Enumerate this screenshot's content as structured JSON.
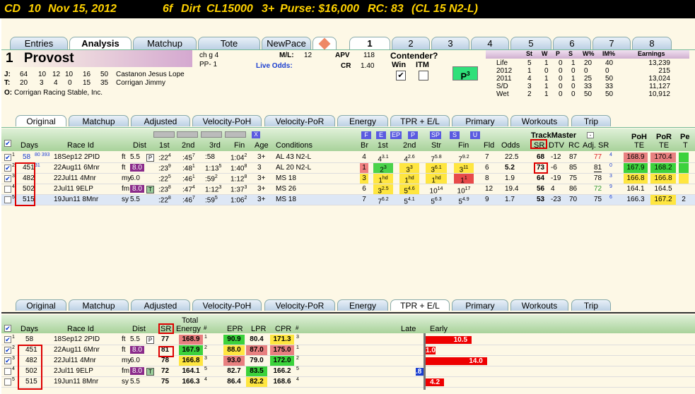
{
  "title": {
    "track": "CD",
    "race": "10",
    "date": "Nov 15, 2012",
    "dist": "6f",
    "surface": "Dirt",
    "class": "CL15000",
    "age": "3+",
    "purse": "Purse: $16,000",
    "rc": "RC: 83",
    "cond": "(CL 15 N2-L)"
  },
  "main_tabs": [
    "Entries",
    "Analysis",
    "Matchup",
    "Tote",
    "NewPace"
  ],
  "post_tabs": [
    "1",
    "2",
    "3",
    "4",
    "5",
    "6",
    "7",
    "8"
  ],
  "horse": {
    "number": "1",
    "name": "Provost",
    "desc": "ch g 4",
    "pp": "PP- 1",
    "ml_label": "M/L:",
    "ml": "12",
    "live_odds": "Live Odds:",
    "apv_label": "APV",
    "apv": "118",
    "cr_label": "CR",
    "cr": "1.40",
    "contender": "Contender?",
    "win": "Win",
    "itm": "ITM",
    "p_badge": "P",
    "p_sup": "3",
    "j_label": "J:",
    "j_stats": [
      "64",
      "10",
      "12",
      "10",
      "16",
      "50"
    ],
    "jockey": "Castanon Jesus Lope",
    "t_label": "T:",
    "t_stats": [
      "20",
      "3",
      "4",
      "0",
      "15",
      "35"
    ],
    "trainer": "Corrigan Jimmy",
    "o_label": "O:",
    "owner": "Corrigan Racing Stable, Inc."
  },
  "record": {
    "headers": [
      "St",
      "W",
      "P",
      "S",
      "W%",
      "IM%",
      "Earnings"
    ],
    "rows": [
      [
        "Life",
        "5",
        "1",
        "0",
        "1",
        "20",
        "40",
        "13,239"
      ],
      [
        "2012",
        "1",
        "0",
        "0",
        "0",
        "0",
        "0",
        "215"
      ],
      [
        "2011",
        "4",
        "1",
        "0",
        "1",
        "25",
        "50",
        "13,024"
      ],
      [
        "S/D",
        "3",
        "1",
        "0",
        "0",
        "33",
        "33",
        "11,127"
      ],
      [
        "Wet",
        "2",
        "1",
        "0",
        "0",
        "50",
        "50",
        "10,912"
      ]
    ]
  },
  "sub_tabs": [
    "Original",
    "Matchup",
    "Adjusted",
    "Velocity-PoH",
    "Velocity-PoR",
    "Energy",
    "TPR + E/L",
    "Primary",
    "Workouts",
    "Trip"
  ],
  "top_table": {
    "headers": {
      "days": "Days",
      "race": "Race Id",
      "dist": "Dist",
      "first": "1st",
      "second": "2nd",
      "third": "3rd",
      "fin": "Fin",
      "age": "Age",
      "cond": "Conditions",
      "br": "Br",
      "c1": "1st",
      "c2": "2nd",
      "str": "Str",
      "cfin": "Fin",
      "fld": "Fld",
      "odds": "Odds",
      "trackmaster": "TrackMaster",
      "sr": "SR",
      "dtv": "DTV",
      "rc": "RC",
      "adjsr": "Adj. SR",
      "poh": "PoH",
      "pohte": "TE",
      "por": "PoR",
      "porte": "TE",
      "pe": "Pe",
      "pete": "T"
    },
    "pace_keys": [
      "F",
      "E",
      "EP",
      "P",
      "SP",
      "S",
      "U"
    ],
    "x_key": "X",
    "rows": [
      {
        "n": "1",
        "days": "58",
        "days_sup": "80 393",
        "race": "18Sep12 2PID",
        "surf": "ft",
        "dist": "5.5",
        "dbadge": "P",
        "f1": ":22",
        "f1s": "4",
        "f2": ":45",
        "f2s": "7",
        "f3": ":58",
        "fin": "1:04",
        "fins": "2",
        "age": "3+",
        "cond": "AL 43 N2-L",
        "br": "4",
        "c1": "4",
        "c1s": "3.1",
        "c2": "4",
        "c2s": "2.6",
        "str": "7",
        "strs": "5.8",
        "cfin": "7",
        "cfins": "9.2",
        "fld": "7",
        "odds": "22.5",
        "sr": "68",
        "dtv": "-12",
        "rc": "87",
        "adj": "77",
        "adjs": "4",
        "poh": "168.9",
        "por": "170.4",
        "pe": ""
      },
      {
        "n": "2",
        "days": "451",
        "days_sup": "31",
        "race": "22Aug11 6Mnr",
        "surf": "ft",
        "dist": "8.0",
        "dbadge": "",
        "f1": ":23",
        "f1s": "9",
        "f2": ":48",
        "f2s": "1",
        "f3": "1:13",
        "f3s": "5",
        "fin": "1:40",
        "fins": "8",
        "age": "3",
        "cond": "AL 20 N2-L",
        "br": "1",
        "c1": "2",
        "c1s": "3",
        "c2": "3",
        "c2s": "3",
        "str": "3",
        "strs": "6.1",
        "cfin": "3",
        "cfins": "11",
        "fld": "6",
        "odds": "5.2",
        "sr": "73",
        "dtv": "-6",
        "rc": "85",
        "adj": "81",
        "adjs": "0",
        "poh": "167.9",
        "por": "168.2",
        "pe": ""
      },
      {
        "n": "3",
        "days": "482",
        "days_sup": "",
        "race": "22Jul11 4Mnr",
        "surf": "my",
        "dist": "6.0",
        "dbadge": "",
        "f1": ":22",
        "f1s": "5",
        "f2": ":46",
        "f2s": "1",
        "f3": ":59",
        "f3s": "2",
        "fin": "1:12",
        "fins": "8",
        "age": "3+",
        "cond": "MS 18",
        "br": "3",
        "c1": "1",
        "c1s": "hd",
        "c2": "1",
        "c2s": "hd",
        "str": "1",
        "strs": "hd",
        "cfin": "1",
        "cfins": "1",
        "fld": "8",
        "odds": "1.9",
        "sr": "64",
        "dtv": "-19",
        "rc": "75",
        "adj": "78",
        "adjs": "3",
        "poh": "166.8",
        "por": "166.8",
        "pe": ""
      },
      {
        "n": "4",
        "days": "502",
        "days_sup": "",
        "race": "2Jul11 9ELP",
        "surf": "fm",
        "dist": "8.0",
        "dbadge": "T",
        "f1": ":23",
        "f1s": "8",
        "f2": ":47",
        "f2s": "4",
        "f3": "1:12",
        "f3s": "3",
        "fin": "1:37",
        "fins": "3",
        "age": "3+",
        "cond": "MS 26",
        "br": "6",
        "c1": "3",
        "c1s": "2.5",
        "c2": "5",
        "c2s": "4.6",
        "str": "10",
        "strs": "14",
        "cfin": "10",
        "cfins": "17",
        "fld": "12",
        "odds": "19.4",
        "sr": "56",
        "dtv": "4",
        "rc": "86",
        "adj": "72",
        "adjs": "9",
        "poh": "164.1",
        "por": "164.5",
        "pe": ""
      },
      {
        "n": "5",
        "days": "515",
        "days_sup": "",
        "race": "19Jun11 8Mnr",
        "surf": "sy",
        "dist": "5.5",
        "dbadge": "",
        "f1": ":22",
        "f1s": "8",
        "f2": ":46",
        "f2s": "7",
        "f3": ":59",
        "f3s": "5",
        "fin": "1:06",
        "fins": "2",
        "age": "3+",
        "cond": "MS 18",
        "br": "7",
        "c1": "7",
        "c1s": "6.2",
        "c2": "5",
        "c2s": "4.1",
        "str": "5",
        "strs": "6.3",
        "cfin": "5",
        "cfins": "4.9",
        "fld": "9",
        "odds": "1.7",
        "sr": "53",
        "dtv": "-23",
        "rc": "70",
        "adj": "75",
        "adjs": "6",
        "poh": "166.3",
        "por": "167.2",
        "pe": "2"
      }
    ]
  },
  "bottom_table": {
    "headers": {
      "days": "Days",
      "race": "Race Id",
      "dist": "Dist",
      "sr": "SR",
      "total": "Total",
      "energy": "Energy",
      "hash": "#",
      "epr": "EPR",
      "lpr": "LPR",
      "cpr": "CPR",
      "hash2": "#",
      "late": "Late",
      "early": "Early"
    },
    "rows": [
      {
        "n": "1",
        "days": "58",
        "race": "18Sep12 2PID",
        "surf": "ft",
        "dist": "5.5",
        "dbadge": "P",
        "sr": "77",
        "energy": "168.9",
        "es": "1",
        "epr": "90.9",
        "lpr": "80.4",
        "cpr": "171.3",
        "cs": "3",
        "bar": "10.5",
        "barval": 10.5
      },
      {
        "n": "2",
        "days": "451",
        "race": "22Aug11 6Mnr",
        "surf": "ft",
        "dist": "8.0",
        "dbadge": "",
        "sr": "81",
        "energy": "167.9",
        "es": "2",
        "epr": "88.0",
        "lpr": "87.0",
        "cpr": "175.0",
        "cs": "1",
        "bar": "1.0",
        "barval": 1.0
      },
      {
        "n": "3",
        "days": "482",
        "race": "22Jul11 4Mnr",
        "surf": "my",
        "dist": "6.0",
        "dbadge": "",
        "sr": "78",
        "energy": "166.8",
        "es": "3",
        "epr": "93.0",
        "lpr": "79.0",
        "cpr": "172.0",
        "cs": "2",
        "bar": "14.0",
        "barval": 14.0
      },
      {
        "n": "4",
        "days": "502",
        "race": "2Jul11 9ELP",
        "surf": "fm",
        "dist": "8.0",
        "dbadge": "T",
        "sr": "72",
        "energy": "164.1",
        "es": "5",
        "epr": "82.7",
        "lpr": "83.5",
        "cpr": "166.2",
        "cs": "5",
        "bar": ".8",
        "barval": -0.8
      },
      {
        "n": "5",
        "days": "515",
        "race": "19Jun11 8Mnr",
        "surf": "sy",
        "dist": "5.5",
        "dbadge": "",
        "sr": "75",
        "energy": "166.3",
        "es": "4",
        "epr": "86.4",
        "lpr": "82.2",
        "cpr": "168.6",
        "cs": "4",
        "bar": "4.2",
        "barval": 4.2
      }
    ]
  }
}
